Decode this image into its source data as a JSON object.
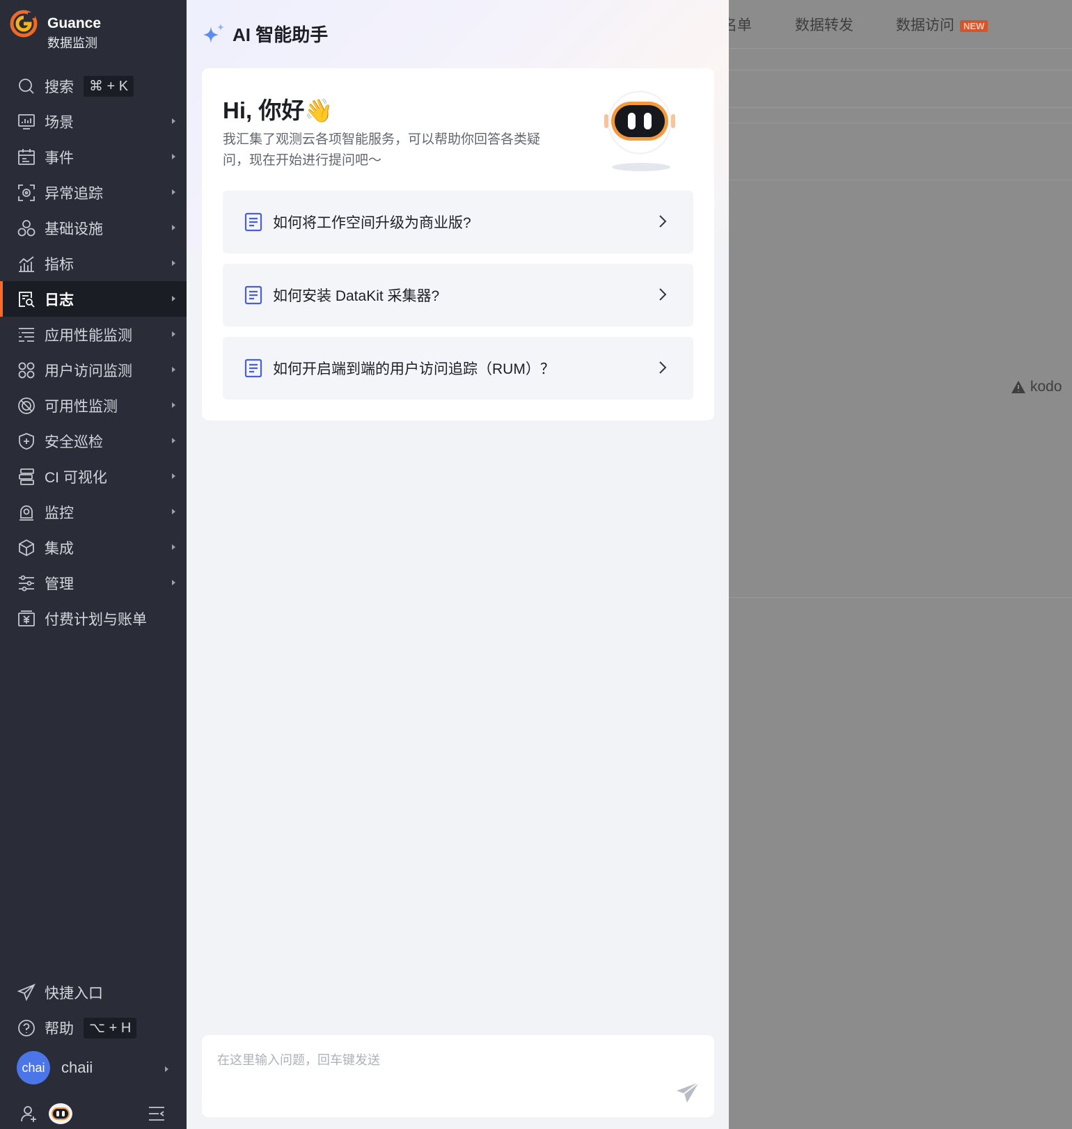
{
  "brand": {
    "name": "Guance",
    "subtitle": "数据监测"
  },
  "sidebar": {
    "search": {
      "label": "搜索",
      "shortcut": "⌘ + K"
    },
    "items": [
      {
        "label": "场景",
        "icon": "dashboard-icon"
      },
      {
        "label": "事件",
        "icon": "calendar-icon"
      },
      {
        "label": "异常追踪",
        "icon": "bug-tracking-icon"
      },
      {
        "label": "基础设施",
        "icon": "infrastructure-icon"
      },
      {
        "label": "指标",
        "icon": "metrics-icon"
      },
      {
        "label": "日志",
        "icon": "log-search-icon",
        "active": true
      },
      {
        "label": "应用性能监测",
        "icon": "apm-icon"
      },
      {
        "label": "用户访问监测",
        "icon": "rum-icon"
      },
      {
        "label": "可用性监测",
        "icon": "availability-icon"
      },
      {
        "label": "安全巡检",
        "icon": "shield-plus-icon"
      },
      {
        "label": "CI 可视化",
        "icon": "ci-icon"
      },
      {
        "label": "监控",
        "icon": "monitor-icon"
      },
      {
        "label": "集成",
        "icon": "cube-icon"
      },
      {
        "label": "管理",
        "icon": "sliders-icon"
      },
      {
        "label": "付费计划与账单",
        "icon": "billing-icon"
      }
    ],
    "shortcut_entry": "快捷入口",
    "help": {
      "label": "帮助",
      "shortcut": "⌥ + H"
    },
    "user": {
      "avatar_text": "chai",
      "name": "chaii"
    }
  },
  "background_page": {
    "tabs": [
      "名单",
      "数据转发",
      "数据访问"
    ],
    "new_badge": "NEW",
    "warning_text": "kodo",
    "accent": "#d2552b"
  },
  "ai_panel": {
    "title": "AI 智能助手",
    "greeting": "Hi, 你好👋",
    "intro": "我汇集了观测云各项智能服务，可以帮助你回答各类疑问，现在开始进行提问吧～",
    "questions": [
      "如何将工作空间升级为商业版?",
      "如何安装 DataKit 采集器?",
      "如何开启端到端的用户访问追踪（RUM）？"
    ],
    "input_placeholder": "在这里输入问题，回车键发送"
  },
  "colors": {
    "sidebar_bg": "#2a2d37",
    "active_accent": "#ff6a2a",
    "doc_icon": "#4a5ed8",
    "avatar_bg": "#4b76e8"
  }
}
